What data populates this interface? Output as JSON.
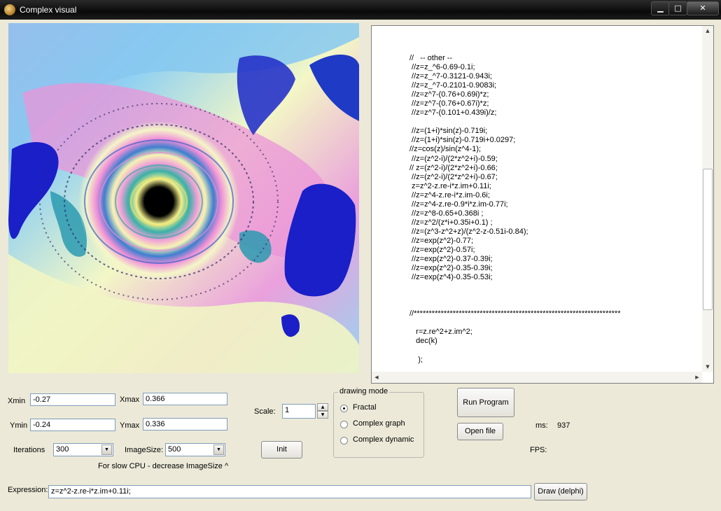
{
  "window": {
    "title": "Complex visual",
    "minimize": "▁",
    "maximize": "□",
    "close": "✕"
  },
  "code_lines": [
    "//   -- other --",
    " //z=z_^6-0.69-0.1i;",
    " //z=z_^7-0.3121-0.943i;",
    " //z=z_^7-0.2101-0.9083i;",
    " //z=z^7-(0.76+0.69i)*z;",
    " //z=z^7-(0.76+0.67i)*z;",
    " //z=z^7-(0.101+0.439i)/z;",
    "",
    " //z=(1+i)*sin(z)-0.719i;",
    " //z=(1+i)*sin(z)-0.719i+0.0297;",
    "//z=cos(z)/sin(z^4-1);",
    " //z=(z^2-i)/(2*z^2+i)-0.59;",
    "// z=(z^2-i)/(2*z^2+i)-0.66;",
    " //z=(z^2-i)/(2*z^2+i)-0.67;",
    " z=z^2-z.re-i*z.im+0.11i;",
    " //z=z^4-z.re-i*z.im-0.6i;",
    " //z=z^4-z.re-0.9*i*z.im-0.77i;",
    " //z=z^8-0.65+0.368i ;",
    " //z=z^2/(z*i+0.35i+0.1) ;",
    " //z=(z^3-z^2+z)/(z^2-z-0.51i-0.84);",
    " //z=exp(z^2)-0.77;",
    " //z=exp(z^2)-0.57i;",
    " //z=exp(z^2)-0.37-0.39i;",
    " //z=exp(z^2)-0.35-0.39i;",
    " //z=exp(z^4)-0.35-0.53i;",
    "",
    "",
    "",
    "//*********************************************************************",
    "",
    "   r=z.re^2+z.im^2;",
    "   dec(k)",
    "",
    "    );"
  ],
  "form": {
    "xmin_label": "Xmin",
    "xmin_value": "-0.27",
    "xmax_label": "Xmax",
    "xmax_value": "0.366",
    "ymin_label": "Ymin",
    "ymin_value": "-0.24",
    "ymax_label": "Ymax",
    "ymax_value": "0.336",
    "iterations_label": "Iterations",
    "iterations_value": "300",
    "imagesize_label": "ImageSize:",
    "imagesize_value": "500",
    "hint": "For slow CPU - decrease ImageSize ^",
    "scale_label": "Scale:",
    "scale_value": "1",
    "init_button": "Init",
    "drawing_mode_title": "drawing mode",
    "modes": [
      "Fractal",
      "Complex graph",
      "Complex dynamic"
    ],
    "selected_mode": "Fractal",
    "run_button": "Run Program",
    "open_button": "Open file",
    "ms_label": "ms:",
    "ms_value": "937",
    "fps_label": "FPS:",
    "expression_label": "Expression:",
    "expression_value": "z=z^2-z.re-i*z.im+0.11i;",
    "draw_button": "Draw (delphi)"
  },
  "colors": {
    "background": "#ece9d8",
    "fractal_blue": "#1a1fc8",
    "fractal_pink": "#e78ad8",
    "fractal_cyan": "#7ec8f0",
    "fractal_yellow": "#f2f6c4"
  },
  "icons": {
    "spin_up": "▲",
    "spin_down": "▼",
    "dropdown": "▼",
    "scroll_up": "▲",
    "scroll_down": "▼",
    "scroll_left": "◀",
    "scroll_right": "▶"
  }
}
